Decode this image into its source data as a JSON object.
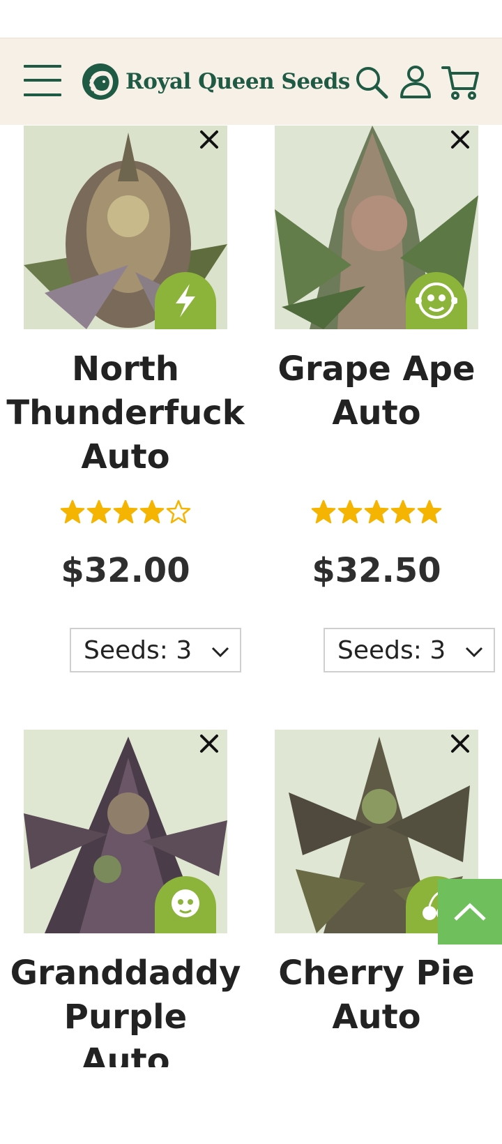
{
  "header": {
    "brand": "Royal Queen Seeds",
    "menu_icon": "hamburger-menu-icon",
    "search_icon": "search-icon",
    "account_icon": "user-icon",
    "cart_icon": "cart-icon",
    "brand_color": "#1f5a45",
    "background_color": "#f6f0e6"
  },
  "products": [
    {
      "name_lines": [
        "North",
        "Thunderfuck",
        "Auto"
      ],
      "rating": 4,
      "rating_max": 5,
      "price": "$32.00",
      "seeds_select": "Seeds: 3",
      "badge_icon": "lightning-icon"
    },
    {
      "name_lines": [
        "Grape Ape",
        "Auto"
      ],
      "rating": 5,
      "rating_max": 5,
      "price": "$32.50",
      "seeds_select": "Seeds: 3",
      "badge_icon": "monkey-face-icon"
    },
    {
      "name_lines": [
        "Granddaddy",
        "Purple",
        "Auto"
      ],
      "badge_icon": "old-man-face-icon"
    },
    {
      "name_lines": [
        "Cherry Pie",
        "Auto"
      ],
      "badge_icon": "cherry-icon"
    }
  ],
  "colors": {
    "star": "#f5b400",
    "badge": "#8db43a",
    "scroll_top": "#6fbf5c"
  },
  "scroll_top_icon": "chevron-up-icon"
}
